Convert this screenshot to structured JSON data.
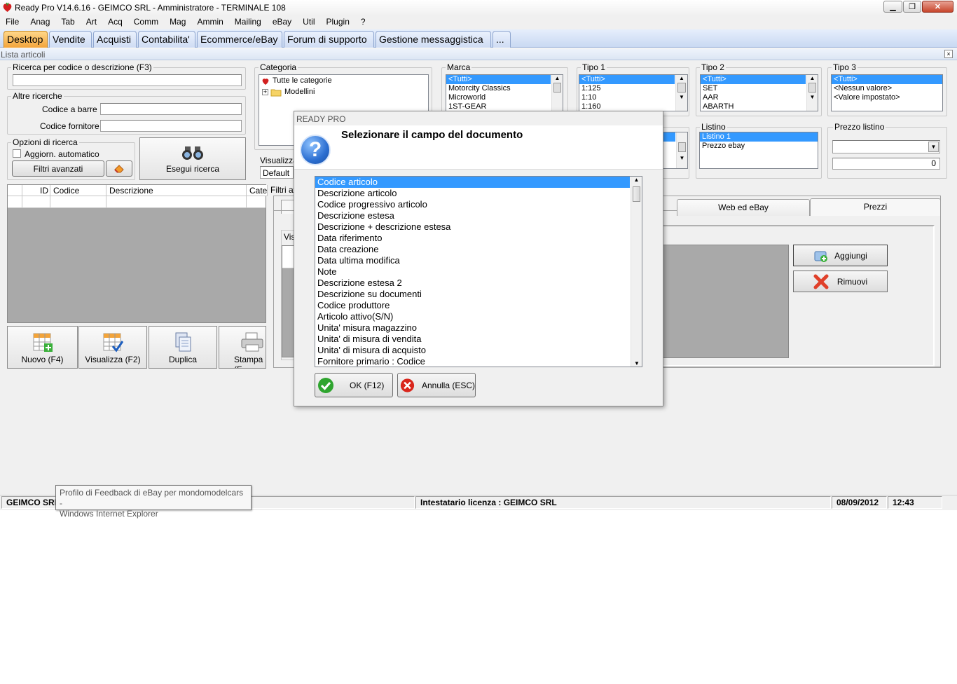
{
  "window": {
    "title": "Ready Pro V14.6.16 - GEIMCO SRL - Amministratore - TERMINALE 108"
  },
  "menu": [
    "File",
    "Anag",
    "Tab",
    "Art",
    "Acq",
    "Comm",
    "Mag",
    "Ammin",
    "Mailing",
    "eBay",
    "Util",
    "Plugin",
    "?"
  ],
  "tabs": [
    {
      "label": "Desktop",
      "active": true
    },
    {
      "label": "Vendite"
    },
    {
      "label": "Acquisti"
    },
    {
      "label": "Contabilita'"
    },
    {
      "label": "Ecommerce/eBay"
    },
    {
      "label": "Forum di supporto"
    },
    {
      "label": "Gestione messaggistica"
    },
    {
      "label": "..."
    }
  ],
  "panel": {
    "title": "Lista articoli"
  },
  "search": {
    "code_group": "Ricerca per codice o descrizione (F3)",
    "other_group": "Altre ricerche",
    "barcode_label": "Codice a barre :",
    "supplier_label": "Codice fornitore :",
    "options_group": "Opzioni di ricerca",
    "auto_update": "Aggiorn. automatico",
    "advanced_filters": "Filtri avanzati",
    "run_search": "Esegui ricerca"
  },
  "categoria": {
    "label": "Categoria",
    "items": [
      "Tutte le categorie",
      "Modellini"
    ]
  },
  "visualizza": {
    "label": "Visualizza",
    "value": "Default"
  },
  "marca": {
    "label": "Marca",
    "items": [
      "<Tutti>",
      "Motorcity Classics",
      "Microworld",
      "1ST-GEAR"
    ]
  },
  "tipo1": {
    "label": "Tipo 1",
    "items": [
      "<Tutti>",
      "1:125",
      "1:10",
      "1:160"
    ]
  },
  "tipo2": {
    "label": "Tipo 2",
    "items": [
      "<Tutti>",
      "SET",
      "AAR",
      "ABARTH"
    ]
  },
  "tipo3": {
    "label": "Tipo 3",
    "items": [
      "<Tutti>",
      "<Nessun valore>",
      "<Valore impostato>"
    ]
  },
  "listino": {
    "label": "Listino",
    "items": [
      "Listino 1",
      "Prezzo ebay"
    ]
  },
  "prezzo_listino": {
    "label": "Prezzo listino",
    "value": "0"
  },
  "grid": {
    "columns": [
      "ID",
      "Codice",
      "Descrizione",
      "Cate"
    ]
  },
  "actions": {
    "new": "Nuovo (F4)",
    "view": "Visualizza (F2)",
    "duplicate": "Duplica",
    "print": "Stampa (F"
  },
  "filters_panel": {
    "label": "Filtri av",
    "vis_label": "Vis",
    "tab_web": "Web ed eBay",
    "tab_prices": "Prezzi",
    "add": "Aggiungi",
    "remove": "Rimuovi"
  },
  "dialog": {
    "caption": "READY PRO",
    "message": "Selezionare il campo del documento",
    "fields": [
      "Codice articolo",
      "Descrizione articolo",
      "Codice progressivo articolo",
      "Descrizione estesa",
      "Descrizione + descrizione estesa",
      "Data riferimento",
      "Data creazione",
      "Data ultima modifica",
      "Note",
      "Descrizione estesa 2",
      "Descrizione su documenti",
      "Codice produttore",
      "Articolo attivo(S/N)",
      "Unita' misura magazzino",
      "Unita' di misura di vendita",
      "Unita' di misura di acquisto",
      "Fornitore primario : Codice"
    ],
    "ok": "OK (F12)",
    "cancel": "Annulla (ESC)"
  },
  "status": {
    "company": "GEIMCO SRL",
    "license": "Intestatario licenza : GEIMCO SRL",
    "date": "08/09/2012",
    "time": "12:43"
  },
  "tooltip": {
    "line1": "Profilo di Feedback di eBay per mondomodelcars -",
    "line2": "Windows Internet Explorer"
  }
}
